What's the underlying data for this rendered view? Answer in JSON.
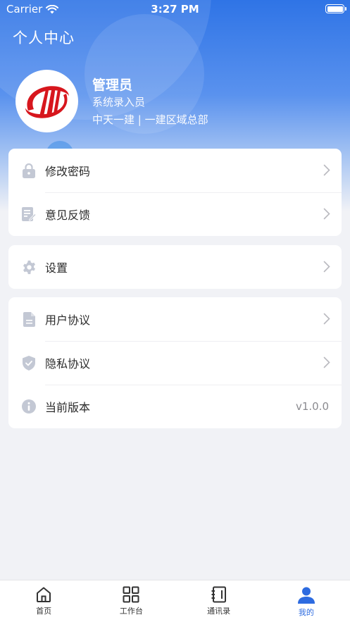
{
  "status_bar": {
    "carrier": "Carrier",
    "time": "3:27 PM"
  },
  "header": {
    "title": "个人中心"
  },
  "profile": {
    "name": "管理员",
    "role": "系统录入员",
    "org": "中天一建 | 一建区域总部"
  },
  "menu_group_1": [
    {
      "label": "修改密码",
      "icon": "lock-icon"
    },
    {
      "label": "意见反馈",
      "icon": "feedback-icon"
    }
  ],
  "menu_group_2": [
    {
      "label": "设置",
      "icon": "gear-icon"
    }
  ],
  "menu_group_3": [
    {
      "label": "用户协议",
      "icon": "document-icon"
    },
    {
      "label": "隐私协议",
      "icon": "shield-icon"
    },
    {
      "label": "当前版本",
      "icon": "info-icon",
      "value": "v1.0.0"
    }
  ],
  "tabbar": [
    {
      "label": "首页",
      "icon": "home-icon"
    },
    {
      "label": "工作台",
      "icon": "grid-icon"
    },
    {
      "label": "通讯录",
      "icon": "contacts-book-icon"
    },
    {
      "label": "我的",
      "icon": "user-icon",
      "active": true
    }
  ],
  "colors": {
    "accent": "#2d6be0",
    "icon_gray": "#c3c8d4",
    "background": "#f1f2f6"
  }
}
